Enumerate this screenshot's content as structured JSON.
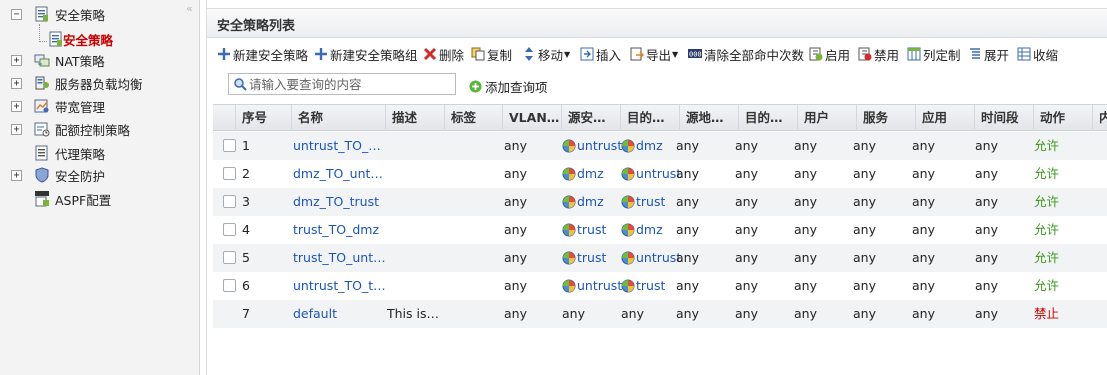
{
  "sidebar": {
    "collapse_glyph": "«",
    "items": [
      {
        "label": "安全策略",
        "toggle": "−",
        "icon": "policy-doc-icon"
      },
      {
        "label": "安全策略",
        "icon": "policy-doc-icon",
        "selected": true
      },
      {
        "label": "NAT策略",
        "toggle": "+",
        "icon": "nat-icon"
      },
      {
        "label": "服务器负载均衡",
        "toggle": "+",
        "icon": "server-lb-icon"
      },
      {
        "label": "带宽管理",
        "toggle": "+",
        "icon": "bandwidth-icon"
      },
      {
        "label": "配额控制策略",
        "toggle": "+",
        "icon": "quota-icon"
      },
      {
        "label": "代理策略",
        "icon": "proxy-icon"
      },
      {
        "label": "安全防护",
        "toggle": "+",
        "icon": "shield-icon"
      },
      {
        "label": "ASPF配置",
        "icon": "aspf-icon"
      }
    ]
  },
  "panel": {
    "title": "安全策略列表"
  },
  "toolbar": {
    "new_policy": "新建安全策略",
    "new_group": "新建安全策略组",
    "delete": "删除",
    "copy": "复制",
    "move": "移动",
    "insert": "插入",
    "export": "导出",
    "clear_hits": "清除全部命中次数",
    "enable": "启用",
    "disable": "禁用",
    "customize_columns": "列定制",
    "expand": "展开",
    "collapse": "收缩"
  },
  "search": {
    "placeholder": "请输入要查询的内容",
    "add_query": "添加查询项"
  },
  "table": {
    "headers": {
      "seq": "序号",
      "name": "名称",
      "desc": "描述",
      "tag": "标签",
      "vlan": "VLAN…",
      "src_zone": "源安…",
      "dst_zone": "目的…",
      "src_addr": "源地…",
      "dst_addr": "目的…",
      "user": "用户",
      "service": "服务",
      "app": "应用",
      "time": "时间段",
      "action": "动作",
      "content": "内容"
    },
    "rows": [
      {
        "seq": "1",
        "name": "untrust_TO_…",
        "desc": "",
        "tag": "",
        "vlan": "any",
        "src": "untrust",
        "dst": "dmz",
        "src_addr": "any",
        "dst_addr": "any",
        "user": "any",
        "service": "any",
        "app": "any",
        "time": "any",
        "action": "允许",
        "action_type": "allow"
      },
      {
        "seq": "2",
        "name": "dmz_TO_unt…",
        "desc": "",
        "tag": "",
        "vlan": "any",
        "src": "dmz",
        "dst": "untrust",
        "src_addr": "any",
        "dst_addr": "any",
        "user": "any",
        "service": "any",
        "app": "any",
        "time": "any",
        "action": "允许",
        "action_type": "allow"
      },
      {
        "seq": "3",
        "name": "dmz_TO_trust",
        "desc": "",
        "tag": "",
        "vlan": "any",
        "src": "dmz",
        "dst": "trust",
        "src_addr": "any",
        "dst_addr": "any",
        "user": "any",
        "service": "any",
        "app": "any",
        "time": "any",
        "action": "允许",
        "action_type": "allow"
      },
      {
        "seq": "4",
        "name": "trust_TO_dmz",
        "desc": "",
        "tag": "",
        "vlan": "any",
        "src": "trust",
        "dst": "dmz",
        "src_addr": "any",
        "dst_addr": "any",
        "user": "any",
        "service": "any",
        "app": "any",
        "time": "any",
        "action": "允许",
        "action_type": "allow"
      },
      {
        "seq": "5",
        "name": "trust_TO_unt…",
        "desc": "",
        "tag": "",
        "vlan": "any",
        "src": "trust",
        "dst": "untrust",
        "src_addr": "any",
        "dst_addr": "any",
        "user": "any",
        "service": "any",
        "app": "any",
        "time": "any",
        "action": "允许",
        "action_type": "allow"
      },
      {
        "seq": "6",
        "name": "untrust_TO_t…",
        "desc": "",
        "tag": "",
        "vlan": "any",
        "src": "untrust",
        "dst": "trust",
        "src_addr": "any",
        "dst_addr": "any",
        "user": "any",
        "service": "any",
        "app": "any",
        "time": "any",
        "action": "允许",
        "action_type": "allow"
      },
      {
        "seq": "7",
        "name": "default",
        "desc": "This is…",
        "tag": "",
        "vlan": "any",
        "src": "any",
        "dst": "any",
        "src_addr": "any",
        "dst_addr": "any",
        "user": "any",
        "service": "any",
        "app": "any",
        "time": "any",
        "action": "禁止",
        "action_type": "deny",
        "plain_zones": true,
        "no_checkbox": true
      }
    ]
  },
  "colors": {
    "link": "#1a56b8",
    "allow": "#3a9a1a",
    "deny": "#cc0000",
    "selected_tree": "#cc0000"
  }
}
